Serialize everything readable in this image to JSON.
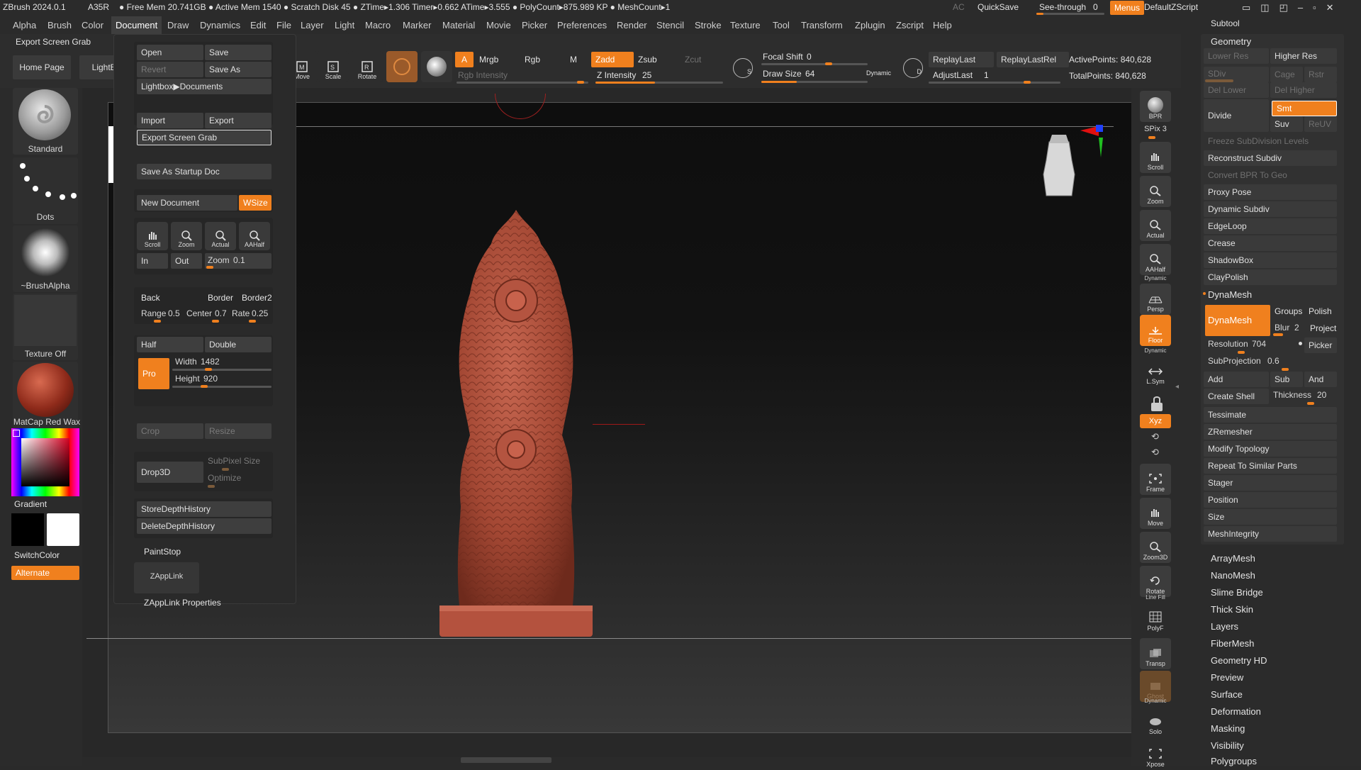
{
  "titlebar": {
    "app": "ZBrush 2024.0.1",
    "a3r": "A35R",
    "stats": "● Free Mem 20.741GB ● Active Mem 1540 ● Scratch Disk 45 ● ZTime▸1.306 Timer▸0.662 ATime▸3.555 ● PolyCount▸875.989 KP ● MeshCount▸1",
    "ac": "AC",
    "quicksave": "QuickSave",
    "seethrough": "See-through",
    "seethrough_val": "0",
    "menus": "Menus",
    "script": "DefaultZScript"
  },
  "menubar": [
    "Alpha",
    "Brush",
    "Color",
    "Document",
    "Draw",
    "Dynamics",
    "Edit",
    "File",
    "Layer",
    "Light",
    "Macro",
    "Marker",
    "Material",
    "Movie",
    "Picker",
    "Preferences",
    "Render",
    "Stencil",
    "Stroke",
    "Texture",
    "Tool",
    "Transform",
    "Zplugin",
    "Zscript",
    "Help"
  ],
  "toolbar": {
    "export_grab": "Export Screen Grab",
    "home": "Home Page",
    "lightbox": "LightBox",
    "move": "Move",
    "scale": "Scale",
    "rotate": "Rotate",
    "a": "A",
    "mrgb": "Mrgb",
    "rgb": "Rgb",
    "m": "M",
    "zadd": "Zadd",
    "zsub": "Zsub",
    "zcut": "Zcut",
    "rgb_int": "Rgb Intensity",
    "z_int": "Z Intensity",
    "z_int_val": "25",
    "focal": "Focal Shift",
    "focal_val": "0",
    "draw": "Draw Size",
    "draw_val": "64",
    "dynamic": "Dynamic",
    "replay": "ReplayLast",
    "replayrel": "ReplayLastRel",
    "adjust": "AdjustLast",
    "adjust_val": "1",
    "active": "ActivePoints: 840,628",
    "total": "TotalPoints: 840,628",
    "s": "S",
    "d": "D"
  },
  "leftshelf": {
    "standard": "Standard",
    "dots": "Dots",
    "brushalpha": "~BrushAlpha",
    "texture": "Texture Off",
    "matcap": "MatCap Red Wax",
    "gradient": "Gradient",
    "switch": "SwitchColor",
    "alternate": "Alternate"
  },
  "doc": {
    "open": "Open",
    "save": "Save",
    "revert": "Revert",
    "saveas": "Save As",
    "lightbox": "Lightbox▶Documents",
    "import": "Import",
    "export": "Export",
    "grab": "Export Screen Grab",
    "startup": "Save As Startup Doc",
    "newdoc": "New Document",
    "wsize": "WSize",
    "scroll": "Scroll",
    "zoom": "Zoom",
    "actual": "Actual",
    "aahalf": "AAHalf",
    "in": "In",
    "out": "Out",
    "zoomlbl": "Zoom",
    "zoomval": "0.1",
    "back": "Back",
    "border": "Border",
    "border2": "Border2",
    "range": "Range",
    "range_val": "0.5",
    "center": "Center",
    "center_val": "0.7",
    "rate": "Rate",
    "rate_val": "0.25",
    "half": "Half",
    "double": "Double",
    "pro": "Pro",
    "width": "Width",
    "width_val": "1482",
    "height": "Height",
    "height_val": "920",
    "crop": "Crop",
    "resize": "Resize",
    "drop3d": "Drop3D",
    "subpixel": "SubPixel Size",
    "optimize": "Optimize",
    "store": "StoreDepthHistory",
    "delete": "DeleteDepthHistory",
    "paintstop": "PaintStop",
    "zapplink": "ZAppLink",
    "zapplinkprops": "ZAppLink Properties"
  },
  "righttools": {
    "bpr": "BPR",
    "spix": "SPix",
    "spix_val": "3",
    "scroll": "Scroll",
    "zoom": "Zoom",
    "actual": "Actual",
    "aahalf": "AAHalf",
    "dynamic": "Dynamic",
    "persp": "Persp",
    "floor": "Floor",
    "lsym": "L.Sym",
    "xyz": "Xyz",
    "frame": "Frame",
    "move": "Move",
    "zoom3d": "Zoom3D",
    "rotate": "Rotate",
    "linefill": "Line Fill",
    "polyf": "PolyF",
    "transp": "Transp",
    "ghost": "Ghost",
    "solo": "Solo",
    "xpose": "Xpose"
  },
  "subtool": {
    "title": "Subtool",
    "geometry": "Geometry",
    "lower": "Lower Res",
    "higher": "Higher Res",
    "sdiv": "SDiv",
    "cage": "Cage",
    "rstr": "Rstr",
    "dellower": "Del Lower",
    "delhigher": "Del Higher",
    "divide": "Divide",
    "smt": "Smt",
    "suv": "Suv",
    "reuv": "ReUV",
    "freeze": "Freeze SubDivision Levels",
    "reconstruct": "Reconstruct Subdiv",
    "convert": "Convert BPR To Geo",
    "proxy": "Proxy Pose",
    "dynsub": "Dynamic Subdiv",
    "edgeloop": "EdgeLoop",
    "crease": "Crease",
    "shadowbox": "ShadowBox",
    "claypolish": "ClayPolish",
    "dynamesh": "DynaMesh",
    "dynabtn": "DynaMesh",
    "groups": "Groups",
    "polish": "Polish",
    "blur": "Blur",
    "blur_val": "2",
    "project": "Project",
    "resolution": "Resolution",
    "res_val": "704",
    "picker": "Picker",
    "subproj": "SubProjection",
    "subproj_val": "0.6",
    "add": "Add",
    "sub": "Sub",
    "and": "And",
    "shell": "Create Shell",
    "thickness": "Thickness",
    "thick_val": "20",
    "tess": "Tessimate",
    "zrem": "ZRemesher",
    "modtopo": "Modify Topology",
    "repeat": "Repeat To Similar Parts",
    "stager": "Stager",
    "position": "Position",
    "size": "Size",
    "integrity": "MeshIntegrity"
  },
  "sections": [
    "ArrayMesh",
    "NanoMesh",
    "Slime Bridge",
    "Thick Skin",
    "Layers",
    "FiberMesh",
    "Geometry HD",
    "Preview",
    "Surface",
    "Deformation",
    "Masking",
    "Visibility",
    "Polygroups"
  ],
  "colors": {
    "accent": "#f0801e",
    "model": "#b4523e"
  }
}
